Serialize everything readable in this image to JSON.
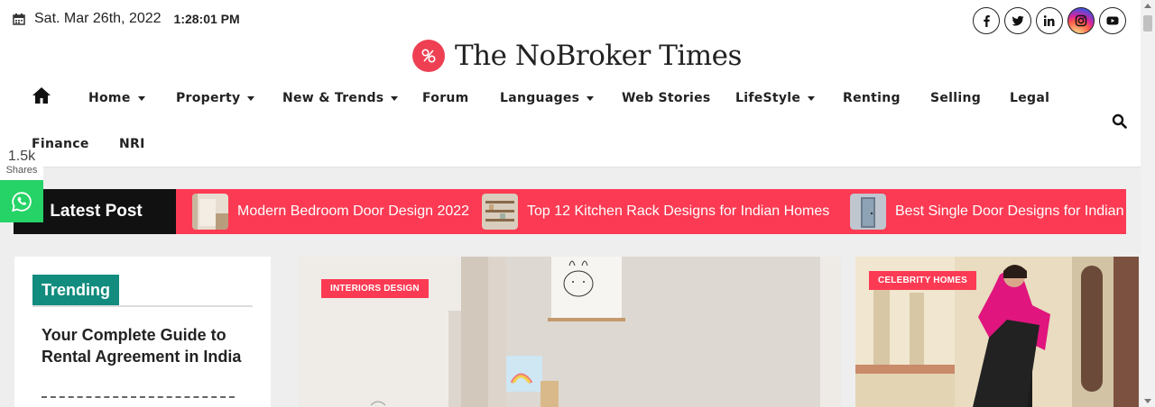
{
  "topbar": {
    "date": "Sat. Mar 26th, 2022",
    "time": "1:28:01 PM",
    "calendar_icon": "calendar-icon"
  },
  "socials": [
    {
      "name": "facebook",
      "icon": "facebook-icon"
    },
    {
      "name": "twitter",
      "icon": "twitter-icon"
    },
    {
      "name": "linkedin",
      "icon": "linkedin-icon"
    },
    {
      "name": "instagram",
      "icon": "instagram-icon"
    },
    {
      "name": "youtube",
      "icon": "youtube-icon"
    }
  ],
  "logo": {
    "text": "The NoBroker Times",
    "brand_color": "#ee3f53"
  },
  "nav": {
    "home_icon": "home-icon",
    "items": [
      {
        "label": "Home",
        "dropdown": true
      },
      {
        "label": "Property",
        "dropdown": true
      },
      {
        "label": "New & Trends",
        "dropdown": true
      },
      {
        "label": "Forum",
        "dropdown": false
      },
      {
        "label": "Languages",
        "dropdown": true
      },
      {
        "label": "Web Stories",
        "dropdown": false
      },
      {
        "label": "LifeStyle",
        "dropdown": true
      },
      {
        "label": "Renting",
        "dropdown": false
      },
      {
        "label": "Selling",
        "dropdown": false
      },
      {
        "label": "Legal",
        "dropdown": false
      },
      {
        "label": "Finance",
        "dropdown": false
      },
      {
        "label": "NRI",
        "dropdown": false
      }
    ],
    "search_icon": "search-icon"
  },
  "share": {
    "count": "1.5k",
    "label": "Shares",
    "whatsapp_icon": "whatsapp-icon"
  },
  "ticker": {
    "label": "Latest Post",
    "accent": "#fc3a53",
    "items": [
      {
        "title": "Modern Bedroom Door Design 2022"
      },
      {
        "title": "Top 12 Kitchen Rack Designs for Indian Homes"
      },
      {
        "title": "Best Single Door Designs for Indian"
      }
    ]
  },
  "trending": {
    "heading": "Trending",
    "accent": "#128c7e",
    "first_title": "Your Complete Guide to Rental Agreement in India"
  },
  "cards": [
    {
      "badge": "INTERIORS DESIGN"
    },
    {
      "badge": "CELEBRITY HOMES"
    }
  ]
}
